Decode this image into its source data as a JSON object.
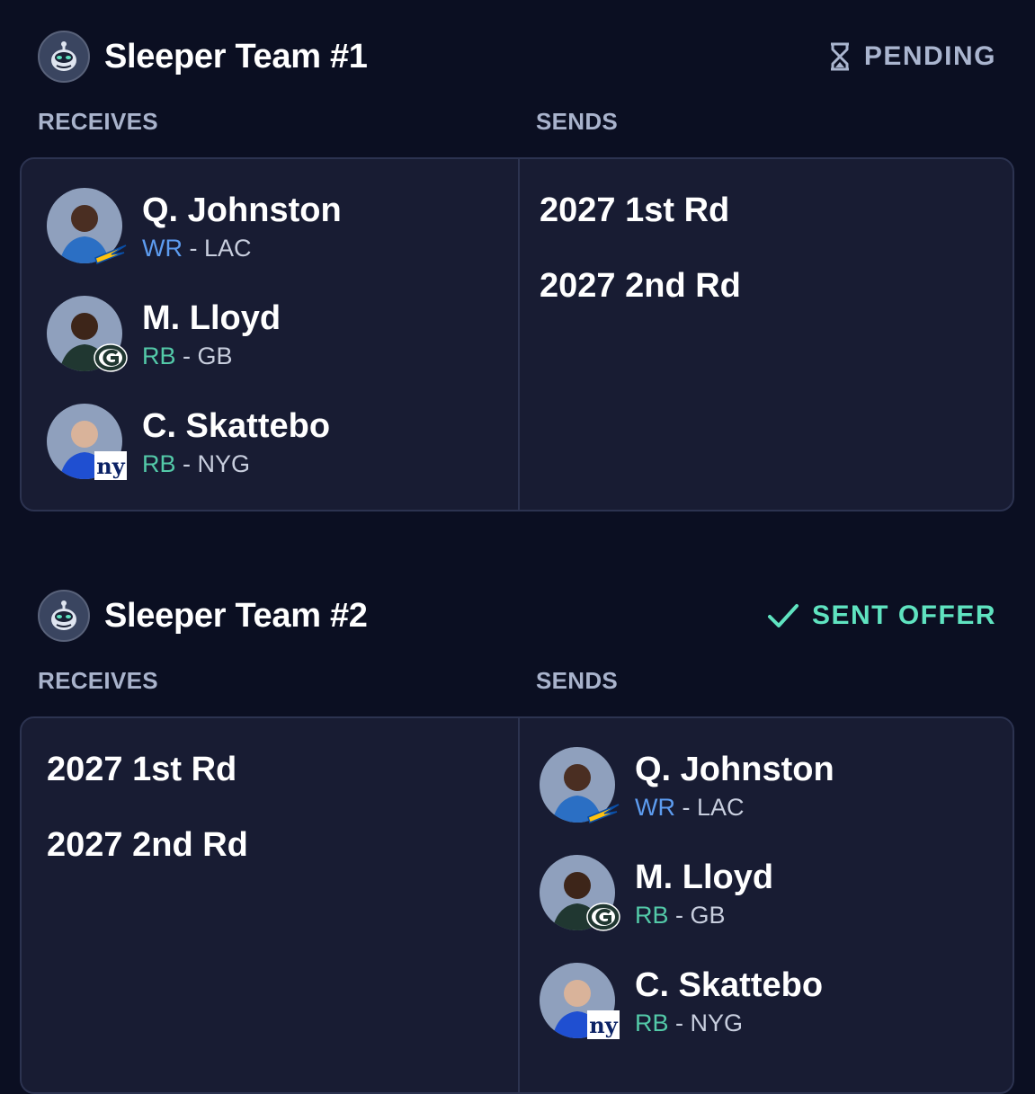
{
  "trades": [
    {
      "team_name": "Sleeper Team #1",
      "status": "PENDING",
      "status_icon": "hourglass-icon",
      "receives_label": "RECEIVES",
      "sends_label": "SENDS",
      "receives_players": [
        {
          "name": "Q. Johnston",
          "position": "WR",
          "team": "LAC"
        },
        {
          "name": "M. Lloyd",
          "position": "RB",
          "team": "GB"
        },
        {
          "name": "C. Skattebo",
          "position": "RB",
          "team": "NYG"
        }
      ],
      "sends_picks": [
        "2027 1st Rd",
        "2027 2nd Rd"
      ]
    },
    {
      "team_name": "Sleeper Team #2",
      "status": "SENT OFFER",
      "status_icon": "checkmark-icon",
      "receives_label": "RECEIVES",
      "sends_label": "SENDS",
      "receives_picks": [
        "2027 1st Rd",
        "2027 2nd Rd"
      ],
      "sends_players": [
        {
          "name": "Q. Johnston",
          "position": "WR",
          "team": "LAC"
        },
        {
          "name": "M. Lloyd",
          "position": "RB",
          "team": "GB"
        },
        {
          "name": "C. Skattebo",
          "position": "RB",
          "team": "NYG"
        }
      ]
    }
  ],
  "colors": {
    "background": "#0b0f22",
    "panel": "#181c33",
    "wr": "#5d9cf0",
    "rb": "#53c9a8",
    "pending": "#aab5cf",
    "sent": "#5fe3c0"
  },
  "separator": " - "
}
